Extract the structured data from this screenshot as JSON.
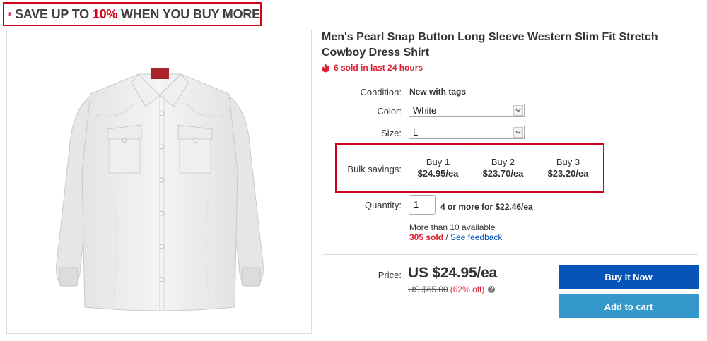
{
  "promo": {
    "prefix": "SAVE UP TO ",
    "accent": "10%",
    "suffix": " WHEN YOU BUY MORE",
    "icon": "price-tag-icon",
    "accent_color": "#d0021b"
  },
  "product": {
    "image_alt_icon": "white-western-shirt-image",
    "title": "Men's Pearl Snap Button Long Sleeve Western Slim Fit Stretch Cowboy Dress Shirt",
    "sold_recent": "6 sold in last 24 hours"
  },
  "details": {
    "condition_label": "Condition:",
    "condition_value": "New with tags",
    "color_label": "Color:",
    "color_value": "White",
    "size_label": "Size:",
    "size_value": "L"
  },
  "bulk": {
    "label": "Bulk savings:",
    "options": [
      {
        "qty": "Buy 1",
        "price": "$24.95/ea",
        "selected": true
      },
      {
        "qty": "Buy 2",
        "price": "$23.70/ea",
        "selected": false
      },
      {
        "qty": "Buy 3",
        "price": "$23.20/ea",
        "selected": false
      }
    ]
  },
  "quantity": {
    "label": "Quantity:",
    "value": "1",
    "note": "4 or more for $22.46/ea",
    "available": "More than 10 available",
    "sold_count": "305 sold",
    "separator": " / ",
    "feedback_link": "See feedback"
  },
  "pricing": {
    "label": "Price:",
    "price": "US $24.95/ea",
    "was": "US $65.00",
    "discount": "(62% off)"
  },
  "actions": {
    "buy_now": "Buy It Now",
    "add_to_cart": "Add to cart",
    "buy_color": "#0654ba",
    "cart_color": "#3498ca"
  }
}
